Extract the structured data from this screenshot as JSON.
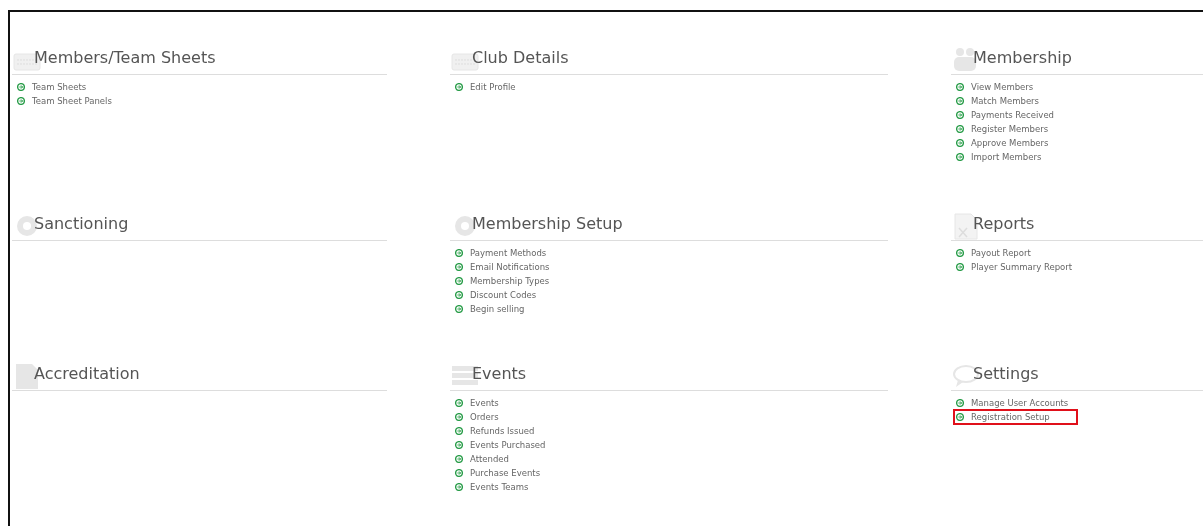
{
  "sections": [
    {
      "title": "Members/Team Sheets",
      "kind": "keyboard",
      "links": [
        {
          "label": "Team Sheets",
          "highlighted": false
        },
        {
          "label": "Team Sheet Panels",
          "highlighted": false
        }
      ]
    },
    {
      "title": "Club Details",
      "kind": "keyboard",
      "links": [
        {
          "label": "Edit Profile",
          "highlighted": false
        }
      ]
    },
    {
      "title": "Membership",
      "kind": "people",
      "links": [
        {
          "label": "View Members",
          "highlighted": false
        },
        {
          "label": "Match Members",
          "highlighted": false
        },
        {
          "label": "Payments Received",
          "highlighted": false
        },
        {
          "label": "Register Members",
          "highlighted": false
        },
        {
          "label": "Approve Members",
          "highlighted": false
        },
        {
          "label": "Import Members",
          "highlighted": false
        }
      ]
    },
    {
      "title": "Sanctioning",
      "kind": "gear"
    },
    {
      "title": "Membership Setup",
      "kind": "gear",
      "links": [
        {
          "label": "Payment Methods",
          "highlighted": false
        },
        {
          "label": "Email Notifications",
          "highlighted": false
        },
        {
          "label": "Membership Types",
          "highlighted": false
        },
        {
          "label": "Discount Codes",
          "highlighted": false
        },
        {
          "label": "Begin selling",
          "highlighted": false
        }
      ]
    },
    {
      "title": "Reports",
      "kind": "spreadsheet",
      "links": [
        {
          "label": "Payout Report",
          "highlighted": false
        },
        {
          "label": "Player Summary Report",
          "highlighted": false
        }
      ]
    },
    {
      "title": "Accreditation",
      "kind": "document"
    },
    {
      "title": "Events",
      "kind": "list",
      "links": [
        {
          "label": "Events",
          "highlighted": false
        },
        {
          "label": "Orders",
          "highlighted": false
        },
        {
          "label": "Refunds Issued",
          "highlighted": false
        },
        {
          "label": "Events Purchased",
          "highlighted": false
        },
        {
          "label": "Attended",
          "highlighted": false
        },
        {
          "label": "Purchase Events",
          "highlighted": false
        },
        {
          "label": "Events Teams",
          "highlighted": false
        }
      ]
    },
    {
      "title": "Settings",
      "kind": "speech",
      "links": [
        {
          "label": "Manage User Accounts",
          "highlighted": false
        },
        {
          "label": "Registration Setup",
          "highlighted": true
        }
      ]
    }
  ]
}
